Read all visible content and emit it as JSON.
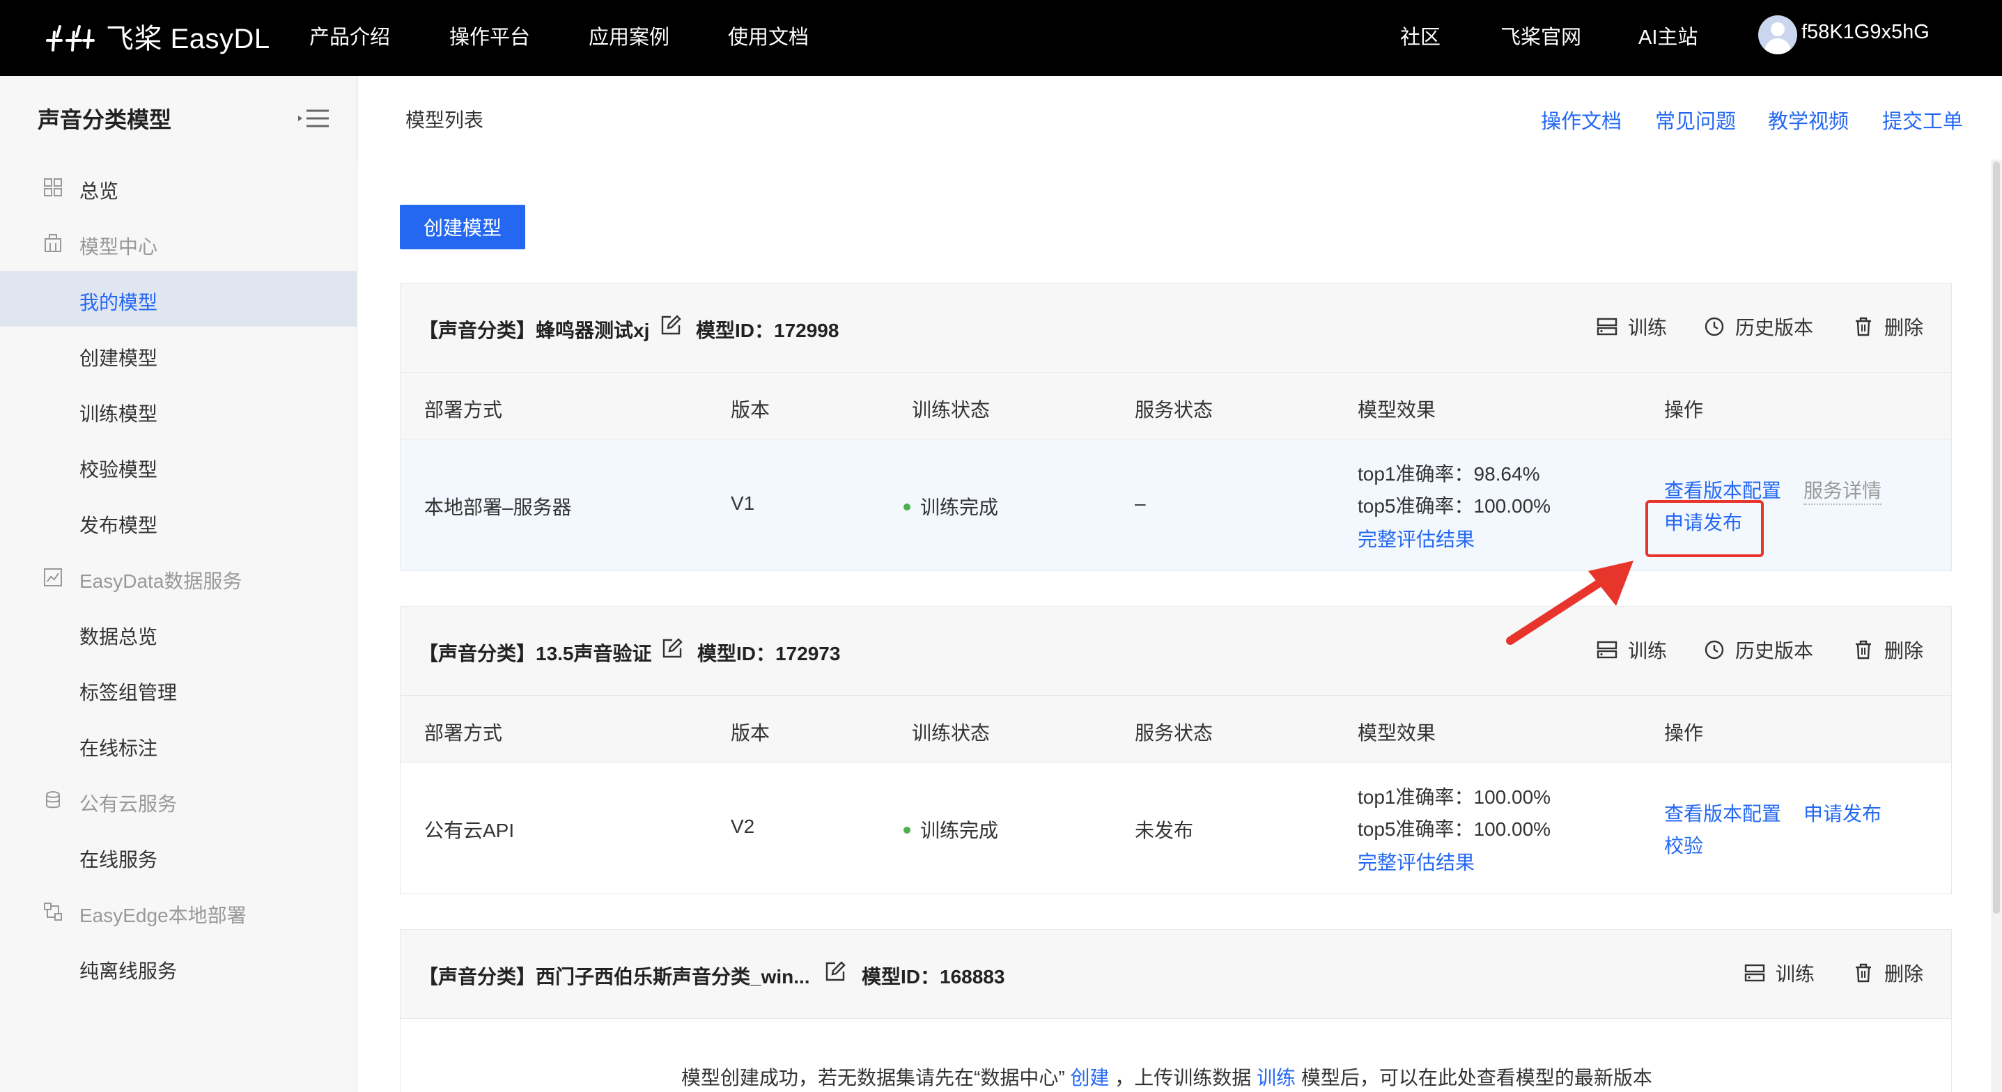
{
  "topnav": {
    "brand": "飞桨 EasyDL",
    "links": [
      "产品介绍",
      "操作平台",
      "应用案例",
      "使用文档"
    ],
    "right_links": [
      "社区",
      "飞桨官网",
      "AI主站"
    ],
    "username": "f58K1G9x5hG"
  },
  "sidebar": {
    "title": "声音分类模型",
    "items": [
      {
        "label": "总览",
        "type": "item",
        "icon": "grid-icon"
      },
      {
        "label": "模型中心",
        "type": "group",
        "icon": "building-icon"
      },
      {
        "label": "我的模型",
        "type": "sub",
        "active": true
      },
      {
        "label": "创建模型",
        "type": "sub"
      },
      {
        "label": "训练模型",
        "type": "sub"
      },
      {
        "label": "校验模型",
        "type": "sub"
      },
      {
        "label": "发布模型",
        "type": "sub"
      },
      {
        "label": "EasyData数据服务",
        "type": "group",
        "icon": "chart-icon"
      },
      {
        "label": "数据总览",
        "type": "sub"
      },
      {
        "label": "标签组管理",
        "type": "sub"
      },
      {
        "label": "在线标注",
        "type": "sub"
      },
      {
        "label": "公有云服务",
        "type": "group",
        "icon": "database-icon"
      },
      {
        "label": "在线服务",
        "type": "sub"
      },
      {
        "label": "EasyEdge本地部署",
        "type": "group",
        "icon": "edge-icon"
      },
      {
        "label": "纯离线服务",
        "type": "sub"
      }
    ]
  },
  "header": {
    "breadcrumb": "模型列表",
    "links": [
      "操作文档",
      "常见问题",
      "教学视频",
      "提交工单"
    ]
  },
  "create_button": "创建模型",
  "table_headers": [
    "部署方式",
    "版本",
    "训练状态",
    "服务状态",
    "模型效果",
    "操作"
  ],
  "models": [
    {
      "title": "【声音分类】蜂鸣器测试xj",
      "model_id": "模型ID：172998",
      "actions": [
        "训练",
        "历史版本",
        "删除"
      ],
      "row": {
        "deploy": "本地部署–服务器",
        "version": "V1",
        "train_status": "训练完成",
        "service_status": "–",
        "effect": [
          "top1准确率：98.64%",
          "top5准确率：100.00%"
        ],
        "effect_link": "完整评估结果",
        "ops": [
          "查看版本配置",
          "服务详情",
          "申请发布"
        ]
      }
    },
    {
      "title": "【声音分类】13.5声音验证",
      "model_id": "模型ID：172973",
      "actions": [
        "训练",
        "历史版本",
        "删除"
      ],
      "row": {
        "deploy": "公有云API",
        "version": "V2",
        "train_status": "训练完成",
        "service_status": "未发布",
        "effect": [
          "top1准确率：100.00%",
          "top5准确率：100.00%"
        ],
        "effect_link": "完整评估结果",
        "ops": [
          "查看版本配置",
          "申请发布",
          "校验"
        ]
      }
    },
    {
      "title": "【声音分类】西门子西伯乐斯声音分类_win...",
      "model_id": "模型ID：168883",
      "actions": [
        "训练",
        "删除"
      ],
      "empty_message": {
        "prefix": "模型创建成功，若无数据集请先在“数据中心”",
        "create_link": "创建",
        "middle": "，上传训练数据",
        "train_link": "训练",
        "suffix": "模型后，可以在此处查看模型的最新版本"
      }
    }
  ],
  "colors": {
    "accent": "#2468f2",
    "highlight_box": "#e8352c",
    "nav_bg": "#000000",
    "success": "#4caf50"
  }
}
